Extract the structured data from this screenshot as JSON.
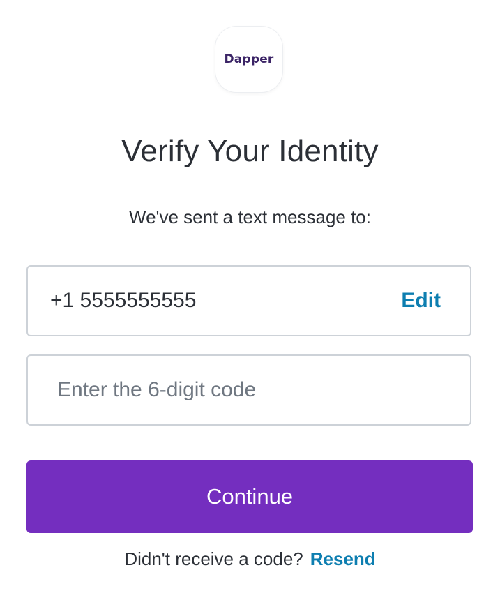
{
  "logo": {
    "text": "Dapper"
  },
  "header": {
    "title": "Verify Your Identity",
    "subtitle": "We've sent a text message to:"
  },
  "phone": {
    "value": "+1 5555555555",
    "edit_label": "Edit"
  },
  "code": {
    "placeholder": "Enter the 6-digit code",
    "value": ""
  },
  "actions": {
    "continue_label": "Continue"
  },
  "resend": {
    "prompt": "Didn't receive a code?",
    "link_label": "Resend"
  },
  "colors": {
    "primary": "#742ebf",
    "link": "#0d7eb0",
    "text": "#2b2f36",
    "border": "#cdd2d8"
  }
}
